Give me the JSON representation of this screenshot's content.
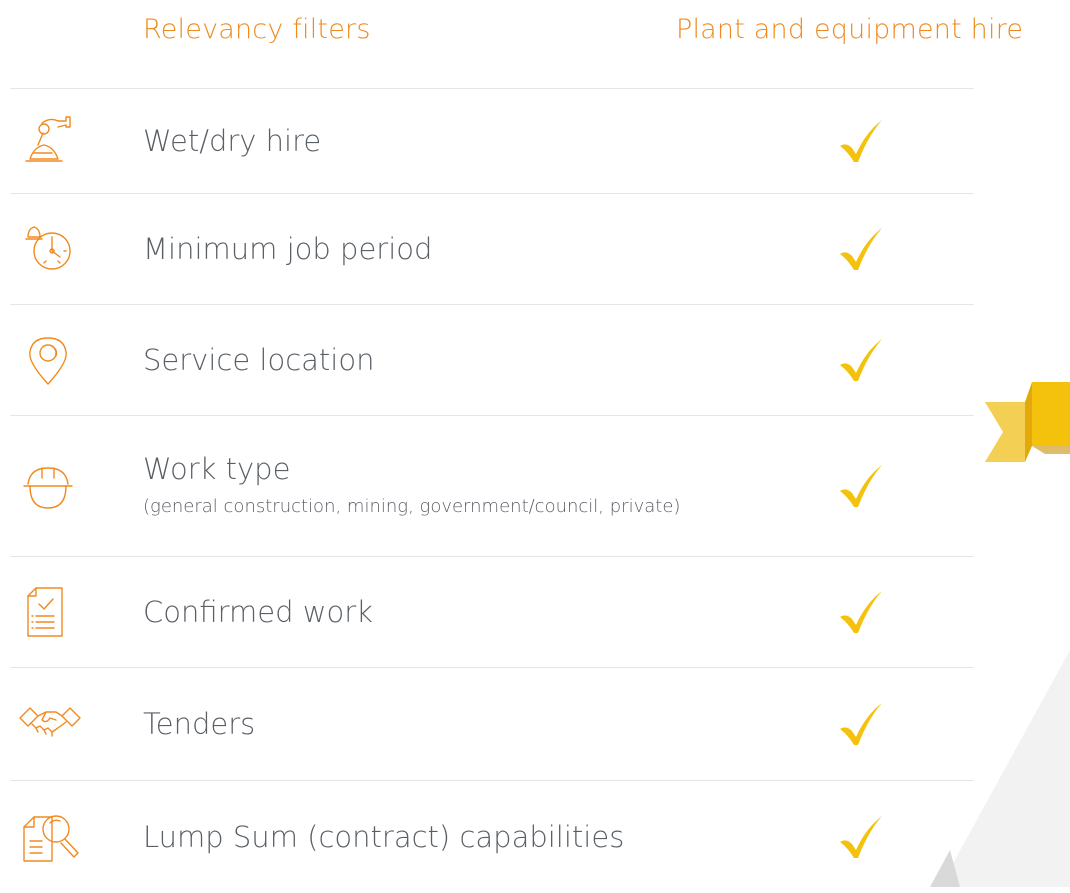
{
  "header": {
    "left_title": "Relevancy filters",
    "right_title": "Plant and equipment hire"
  },
  "colors": {
    "accent_orange": "#f08a1e",
    "check_yellow": "#f4c20d",
    "divider": "#e6e6e6",
    "text": "#5a5f66"
  },
  "rows": [
    {
      "label": "Wet/dry hire",
      "sub": "",
      "icon": "hand-shovel-icon",
      "checked": true
    },
    {
      "label": "Minimum job period",
      "sub": "",
      "icon": "alarm-clock-icon",
      "checked": true
    },
    {
      "label": "Service location",
      "sub": "",
      "icon": "map-pin-icon",
      "checked": true
    },
    {
      "label": "Work type",
      "sub": "(general construction, mining, government/council, private)",
      "icon": "hard-hat-icon",
      "checked": true
    },
    {
      "label": "Confirmed work",
      "sub": "",
      "icon": "checklist-document-icon",
      "checked": true
    },
    {
      "label": "Tenders",
      "sub": "",
      "icon": "handshake-icon",
      "checked": true
    },
    {
      "label": "Lump Sum (contract) capabilities",
      "sub": "",
      "icon": "document-search-icon",
      "checked": true
    }
  ]
}
